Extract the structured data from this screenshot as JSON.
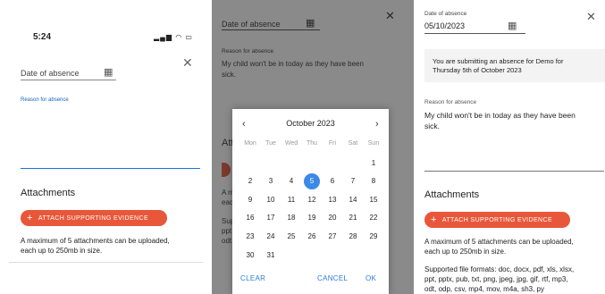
{
  "screen1": {
    "status_time": "5:24",
    "date_label": "Date of absence",
    "reason_label": "Reason for absence",
    "attachments_title": "Attachments",
    "attach_button": "ATTACH SUPPORTING EVIDENCE",
    "limit_line1": "A maximum of 5 attachments can be uploaded,",
    "limit_line2": "each up to 250mb in size."
  },
  "screen2": {
    "date_label": "Date of absence",
    "reason_label": "Reason for absence",
    "reason_line1": "My child won't be in today as they have been",
    "reason_line2": "sick.",
    "bg_fragments": [
      "Att",
      "A m",
      "eac",
      "Sup",
      "ppt",
      "odt"
    ],
    "picker": {
      "month": "October 2023",
      "weekdays": [
        "Mon",
        "Tue",
        "Wed",
        "Thu",
        "Fri",
        "Sat",
        "Sun"
      ],
      "weeks": [
        [
          "",
          "",
          "",
          "",
          "",
          "",
          "1"
        ],
        [
          "2",
          "3",
          "4",
          "5",
          "6",
          "7",
          "8"
        ],
        [
          "9",
          "10",
          "11",
          "12",
          "13",
          "14",
          "15"
        ],
        [
          "16",
          "17",
          "18",
          "19",
          "20",
          "21",
          "22"
        ],
        [
          "23",
          "24",
          "25",
          "26",
          "27",
          "28",
          "29"
        ],
        [
          "30",
          "31",
          "",
          "",
          "",
          "",
          ""
        ]
      ],
      "selected": "5",
      "clear": "CLEAR",
      "cancel": "CANCEL",
      "ok": "OK"
    }
  },
  "screen3": {
    "date_label": "Date of absence",
    "date_value": "05/10/2023",
    "info_line1": "You are submitting an absence for Demo for",
    "info_line2": "Thursday 5th of October 2023",
    "reason_label": "Reason for absence",
    "reason_line1": "My child won't be in today as they have been",
    "reason_line2": "sick.",
    "attachments_title": "Attachments",
    "attach_button": "ATTACH SUPPORTING EVIDENCE",
    "limit_line1": "A maximum of 5 attachments can be uploaded,",
    "limit_line2": "each up to 250mb in size.",
    "formats_line1": "Supported file formats: doc, docx, pdf, xls, xlsx,",
    "formats_line2": "ppt, pptx, pub, txt, png, jpeg, jpg, gif, rtf, mp3,",
    "formats_line3": "odt, odp, csv, mp4, mov, m4a, sh3, py"
  },
  "colors": {
    "accent": "#e8573a",
    "link": "#1565c0",
    "selected": "#3b8ae6"
  }
}
